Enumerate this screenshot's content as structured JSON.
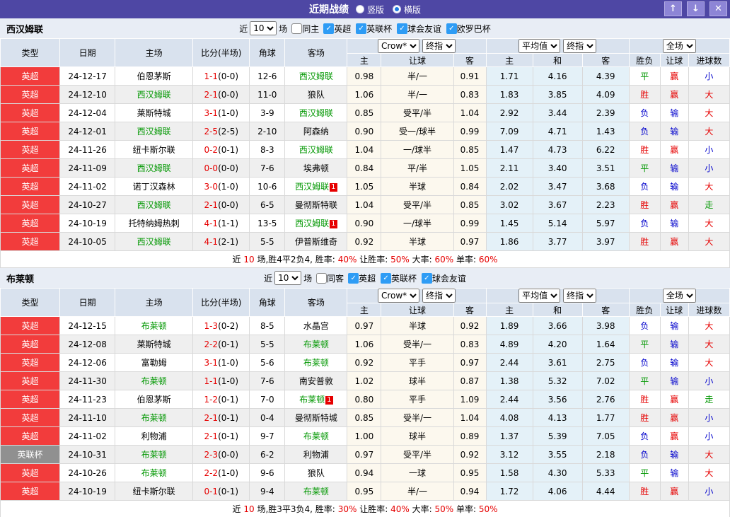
{
  "titlebar": {
    "title": "近期战绩",
    "radios": [
      {
        "label": "竖版",
        "checked": false
      },
      {
        "label": "横版",
        "checked": true
      }
    ],
    "selected": "横版",
    "icons": {
      "up": "↑",
      "down": "↓",
      "close": "✕"
    },
    "colors": {
      "bar": "#4e47a4",
      "button": "#8d85d6"
    }
  },
  "colors": {
    "epl_badge": "#f23c3c",
    "cup_badge": "#909090",
    "win_red": "#e60000",
    "draw_green": "#009700",
    "lose_blue": "#0000cc",
    "self_team_green": "#009700",
    "odds_bg": "#fcf8ee",
    "avg_bg": "#e4f1f8"
  },
  "sections": [
    {
      "team": "西汉姆联",
      "filter": {
        "near_label": "近",
        "count": "10",
        "games_label": "场",
        "same_label": "同主",
        "leagues": [
          "英超",
          "英联杯",
          "球会友谊",
          "欧罗巴杯"
        ]
      },
      "controls": {
        "crow": "Crow*",
        "fin": "终指",
        "avg": "平均值",
        "fin2": "终指",
        "scope": "全场"
      },
      "columns": {
        "type": "类型",
        "date": "日期",
        "home": "主场",
        "score": "比分(半场)",
        "corner": "角球",
        "away": "客场",
        "h": "主",
        "handicap": "让球",
        "a": "客",
        "avg_h": "主",
        "avg_d": "和",
        "avg_a": "客",
        "wl": "胜负",
        "hcp": "让球",
        "goals": "进球数"
      },
      "rows": [
        {
          "league": "英超",
          "lg": "epl",
          "date": "24-12-17",
          "home": "伯恩茅斯",
          "hc": "norm",
          "hb": "",
          "score": "1-1",
          "half": "(0-0)",
          "corner": "12-6",
          "away": "西汉姆联",
          "ac": "self",
          "ab": "",
          "crow": [
            "0.98",
            "半/一",
            "0.91"
          ],
          "avg": [
            "1.71",
            "4.16",
            "4.39"
          ],
          "res": [
            "平",
            "赢",
            "小"
          ],
          "resc": [
            "green",
            "red",
            "blue"
          ]
        },
        {
          "league": "英超",
          "lg": "epl",
          "date": "24-12-10",
          "home": "西汉姆联",
          "hc": "self",
          "hb": "",
          "score": "2-1",
          "half": "(0-0)",
          "corner": "11-0",
          "away": "狼队",
          "ac": "norm",
          "ab": "",
          "crow": [
            "1.06",
            "半/一",
            "0.83"
          ],
          "avg": [
            "1.83",
            "3.85",
            "4.09"
          ],
          "res": [
            "胜",
            "赢",
            "大"
          ],
          "resc": [
            "red",
            "red",
            "red"
          ]
        },
        {
          "league": "英超",
          "lg": "epl",
          "date": "24-12-04",
          "home": "莱斯特城",
          "hc": "norm",
          "hb": "",
          "score": "3-1",
          "half": "(1-0)",
          "corner": "3-9",
          "away": "西汉姆联",
          "ac": "self",
          "ab": "",
          "crow": [
            "0.85",
            "受平/半",
            "1.04"
          ],
          "avg": [
            "2.92",
            "3.44",
            "2.39"
          ],
          "res": [
            "负",
            "输",
            "大"
          ],
          "resc": [
            "blue",
            "blue",
            "red"
          ]
        },
        {
          "league": "英超",
          "lg": "epl",
          "date": "24-12-01",
          "home": "西汉姆联",
          "hc": "self",
          "hb": "",
          "score": "2-5",
          "half": "(2-5)",
          "corner": "2-10",
          "away": "阿森纳",
          "ac": "norm",
          "ab": "",
          "crow": [
            "0.90",
            "受一/球半",
            "0.99"
          ],
          "avg": [
            "7.09",
            "4.71",
            "1.43"
          ],
          "res": [
            "负",
            "输",
            "大"
          ],
          "resc": [
            "blue",
            "blue",
            "red"
          ]
        },
        {
          "league": "英超",
          "lg": "epl",
          "date": "24-11-26",
          "home": "纽卡斯尔联",
          "hc": "norm",
          "hb": "",
          "score": "0-2",
          "half": "(0-1)",
          "corner": "8-3",
          "away": "西汉姆联",
          "ac": "self",
          "ab": "",
          "crow": [
            "1.04",
            "一/球半",
            "0.85"
          ],
          "avg": [
            "1.47",
            "4.73",
            "6.22"
          ],
          "res": [
            "胜",
            "赢",
            "小"
          ],
          "resc": [
            "red",
            "red",
            "blue"
          ]
        },
        {
          "league": "英超",
          "lg": "epl",
          "date": "24-11-09",
          "home": "西汉姆联",
          "hc": "self",
          "hb": "",
          "score": "0-0",
          "half": "(0-0)",
          "corner": "7-6",
          "away": "埃弗顿",
          "ac": "norm",
          "ab": "",
          "crow": [
            "0.84",
            "平/半",
            "1.05"
          ],
          "avg": [
            "2.11",
            "3.40",
            "3.51"
          ],
          "res": [
            "平",
            "输",
            "小"
          ],
          "resc": [
            "green",
            "blue",
            "blue"
          ]
        },
        {
          "league": "英超",
          "lg": "epl",
          "date": "24-11-02",
          "home": "诺丁汉森林",
          "hc": "norm",
          "hb": "",
          "score": "3-0",
          "half": "(1-0)",
          "corner": "10-6",
          "away": "西汉姆联",
          "ac": "self",
          "ab": "1",
          "crow": [
            "1.05",
            "半球",
            "0.84"
          ],
          "avg": [
            "2.02",
            "3.47",
            "3.68"
          ],
          "res": [
            "负",
            "输",
            "大"
          ],
          "resc": [
            "blue",
            "blue",
            "red"
          ]
        },
        {
          "league": "英超",
          "lg": "epl",
          "date": "24-10-27",
          "home": "西汉姆联",
          "hc": "self",
          "hb": "",
          "score": "2-1",
          "half": "(0-0)",
          "corner": "6-5",
          "away": "曼彻斯特联",
          "ac": "norm",
          "ab": "",
          "crow": [
            "1.04",
            "受平/半",
            "0.85"
          ],
          "avg": [
            "3.02",
            "3.67",
            "2.23"
          ],
          "res": [
            "胜",
            "赢",
            "走"
          ],
          "resc": [
            "red",
            "red",
            "green"
          ]
        },
        {
          "league": "英超",
          "lg": "epl",
          "date": "24-10-19",
          "home": "托特纳姆热刺",
          "hc": "norm",
          "hb": "",
          "score": "4-1",
          "half": "(1-1)",
          "corner": "13-5",
          "away": "西汉姆联",
          "ac": "self",
          "ab": "1",
          "crow": [
            "0.90",
            "一/球半",
            "0.99"
          ],
          "avg": [
            "1.45",
            "5.14",
            "5.97"
          ],
          "res": [
            "负",
            "输",
            "大"
          ],
          "resc": [
            "blue",
            "blue",
            "red"
          ]
        },
        {
          "league": "英超",
          "lg": "epl",
          "date": "24-10-05",
          "home": "西汉姆联",
          "hc": "self",
          "hb": "",
          "score": "4-1",
          "half": "(2-1)",
          "corner": "5-5",
          "away": "伊普斯维奇",
          "ac": "norm",
          "ab": "",
          "crow": [
            "0.92",
            "半球",
            "0.97"
          ],
          "avg": [
            "1.86",
            "3.77",
            "3.97"
          ],
          "res": [
            "胜",
            "赢",
            "大"
          ],
          "resc": [
            "red",
            "red",
            "red"
          ]
        }
      ],
      "summary": [
        {
          "t": "近",
          "c": "plain"
        },
        {
          "t": "10",
          "c": "red"
        },
        {
          "t": "场,胜4平2负4, 胜率:",
          "c": "plain"
        },
        {
          "t": "40%",
          "c": "red"
        },
        {
          "t": " 让胜率:",
          "c": "plain"
        },
        {
          "t": "50%",
          "c": "red"
        },
        {
          "t": " 大率:",
          "c": "plain"
        },
        {
          "t": "60%",
          "c": "red"
        },
        {
          "t": " 单率:",
          "c": "plain"
        },
        {
          "t": "60%",
          "c": "red"
        }
      ]
    },
    {
      "team": "布莱顿",
      "filter": {
        "near_label": "近",
        "count": "10",
        "games_label": "场",
        "same_label": "同客",
        "leagues": [
          "英超",
          "英联杯",
          "球会友谊"
        ]
      },
      "controls": {
        "crow": "Crow*",
        "fin": "终指",
        "avg": "平均值",
        "fin2": "终指",
        "scope": "全场"
      },
      "columns": {
        "type": "类型",
        "date": "日期",
        "home": "主场",
        "score": "比分(半场)",
        "corner": "角球",
        "away": "客场",
        "h": "主",
        "handicap": "让球",
        "a": "客",
        "avg_h": "主",
        "avg_d": "和",
        "avg_a": "客",
        "wl": "胜负",
        "hcp": "让球",
        "goals": "进球数"
      },
      "rows": [
        {
          "league": "英超",
          "lg": "epl",
          "date": "24-12-15",
          "home": "布莱顿",
          "hc": "self",
          "hb": "",
          "score": "1-3",
          "half": "(0-2)",
          "corner": "8-5",
          "away": "水晶宫",
          "ac": "norm",
          "ab": "",
          "crow": [
            "0.97",
            "半球",
            "0.92"
          ],
          "avg": [
            "1.89",
            "3.66",
            "3.98"
          ],
          "res": [
            "负",
            "输",
            "大"
          ],
          "resc": [
            "blue",
            "blue",
            "red"
          ]
        },
        {
          "league": "英超",
          "lg": "epl",
          "date": "24-12-08",
          "home": "莱斯特城",
          "hc": "norm",
          "hb": "",
          "score": "2-2",
          "half": "(0-1)",
          "corner": "5-5",
          "away": "布莱顿",
          "ac": "self",
          "ab": "",
          "crow": [
            "1.06",
            "受半/一",
            "0.83"
          ],
          "avg": [
            "4.89",
            "4.20",
            "1.64"
          ],
          "res": [
            "平",
            "输",
            "大"
          ],
          "resc": [
            "green",
            "blue",
            "red"
          ]
        },
        {
          "league": "英超",
          "lg": "epl",
          "date": "24-12-06",
          "home": "富勒姆",
          "hc": "norm",
          "hb": "",
          "score": "3-1",
          "half": "(1-0)",
          "corner": "5-6",
          "away": "布莱顿",
          "ac": "self",
          "ab": "",
          "crow": [
            "0.92",
            "平手",
            "0.97"
          ],
          "avg": [
            "2.44",
            "3.61",
            "2.75"
          ],
          "res": [
            "负",
            "输",
            "大"
          ],
          "resc": [
            "blue",
            "blue",
            "red"
          ]
        },
        {
          "league": "英超",
          "lg": "epl",
          "date": "24-11-30",
          "home": "布莱顿",
          "hc": "self",
          "hb": "",
          "score": "1-1",
          "half": "(1-0)",
          "corner": "7-6",
          "away": "南安普敦",
          "ac": "norm",
          "ab": "",
          "crow": [
            "1.02",
            "球半",
            "0.87"
          ],
          "avg": [
            "1.38",
            "5.32",
            "7.02"
          ],
          "res": [
            "平",
            "输",
            "小"
          ],
          "resc": [
            "green",
            "blue",
            "blue"
          ]
        },
        {
          "league": "英超",
          "lg": "epl",
          "date": "24-11-23",
          "home": "伯恩茅斯",
          "hc": "norm",
          "hb": "",
          "score": "1-2",
          "half": "(0-1)",
          "corner": "7-0",
          "away": "布莱顿",
          "ac": "self",
          "ab": "1",
          "crow": [
            "0.80",
            "平手",
            "1.09"
          ],
          "avg": [
            "2.44",
            "3.56",
            "2.76"
          ],
          "res": [
            "胜",
            "赢",
            "走"
          ],
          "resc": [
            "red",
            "red",
            "green"
          ]
        },
        {
          "league": "英超",
          "lg": "epl",
          "date": "24-11-10",
          "home": "布莱顿",
          "hc": "self",
          "hb": "",
          "score": "2-1",
          "half": "(0-1)",
          "corner": "0-4",
          "away": "曼彻斯特城",
          "ac": "norm",
          "ab": "",
          "crow": [
            "0.85",
            "受半/一",
            "1.04"
          ],
          "avg": [
            "4.08",
            "4.13",
            "1.77"
          ],
          "res": [
            "胜",
            "赢",
            "小"
          ],
          "resc": [
            "red",
            "red",
            "blue"
          ]
        },
        {
          "league": "英超",
          "lg": "epl",
          "date": "24-11-02",
          "home": "利物浦",
          "hc": "norm",
          "hb": "",
          "score": "2-1",
          "half": "(0-1)",
          "corner": "9-7",
          "away": "布莱顿",
          "ac": "self",
          "ab": "",
          "crow": [
            "1.00",
            "球半",
            "0.89"
          ],
          "avg": [
            "1.37",
            "5.39",
            "7.05"
          ],
          "res": [
            "负",
            "赢",
            "小"
          ],
          "resc": [
            "blue",
            "red",
            "blue"
          ]
        },
        {
          "league": "英联杯",
          "lg": "cup",
          "date": "24-10-31",
          "home": "布莱顿",
          "hc": "self",
          "hb": "",
          "score": "2-3",
          "half": "(0-0)",
          "corner": "6-2",
          "away": "利物浦",
          "ac": "norm",
          "ab": "",
          "crow": [
            "0.97",
            "受平/半",
            "0.92"
          ],
          "avg": [
            "3.12",
            "3.55",
            "2.18"
          ],
          "res": [
            "负",
            "输",
            "大"
          ],
          "resc": [
            "blue",
            "blue",
            "red"
          ]
        },
        {
          "league": "英超",
          "lg": "epl",
          "date": "24-10-26",
          "home": "布莱顿",
          "hc": "self",
          "hb": "",
          "score": "2-2",
          "half": "(1-0)",
          "corner": "9-6",
          "away": "狼队",
          "ac": "norm",
          "ab": "",
          "crow": [
            "0.94",
            "一球",
            "0.95"
          ],
          "avg": [
            "1.58",
            "4.30",
            "5.33"
          ],
          "res": [
            "平",
            "输",
            "大"
          ],
          "resc": [
            "green",
            "blue",
            "red"
          ]
        },
        {
          "league": "英超",
          "lg": "epl",
          "date": "24-10-19",
          "home": "纽卡斯尔联",
          "hc": "norm",
          "hb": "",
          "score": "0-1",
          "half": "(0-1)",
          "corner": "9-4",
          "away": "布莱顿",
          "ac": "self",
          "ab": "",
          "crow": [
            "0.95",
            "半/一",
            "0.94"
          ],
          "avg": [
            "1.72",
            "4.06",
            "4.44"
          ],
          "res": [
            "胜",
            "赢",
            "小"
          ],
          "resc": [
            "red",
            "red",
            "blue"
          ]
        }
      ],
      "summary": [
        {
          "t": "近",
          "c": "plain"
        },
        {
          "t": "10",
          "c": "red"
        },
        {
          "t": "场,胜3平3负4, 胜率:",
          "c": "plain"
        },
        {
          "t": "30%",
          "c": "red"
        },
        {
          "t": " 让胜率:",
          "c": "plain"
        },
        {
          "t": "40%",
          "c": "red"
        },
        {
          "t": " 大率:",
          "c": "plain"
        },
        {
          "t": "50%",
          "c": "red"
        },
        {
          "t": " 单率:",
          "c": "plain"
        },
        {
          "t": "50%",
          "c": "red"
        }
      ]
    }
  ]
}
